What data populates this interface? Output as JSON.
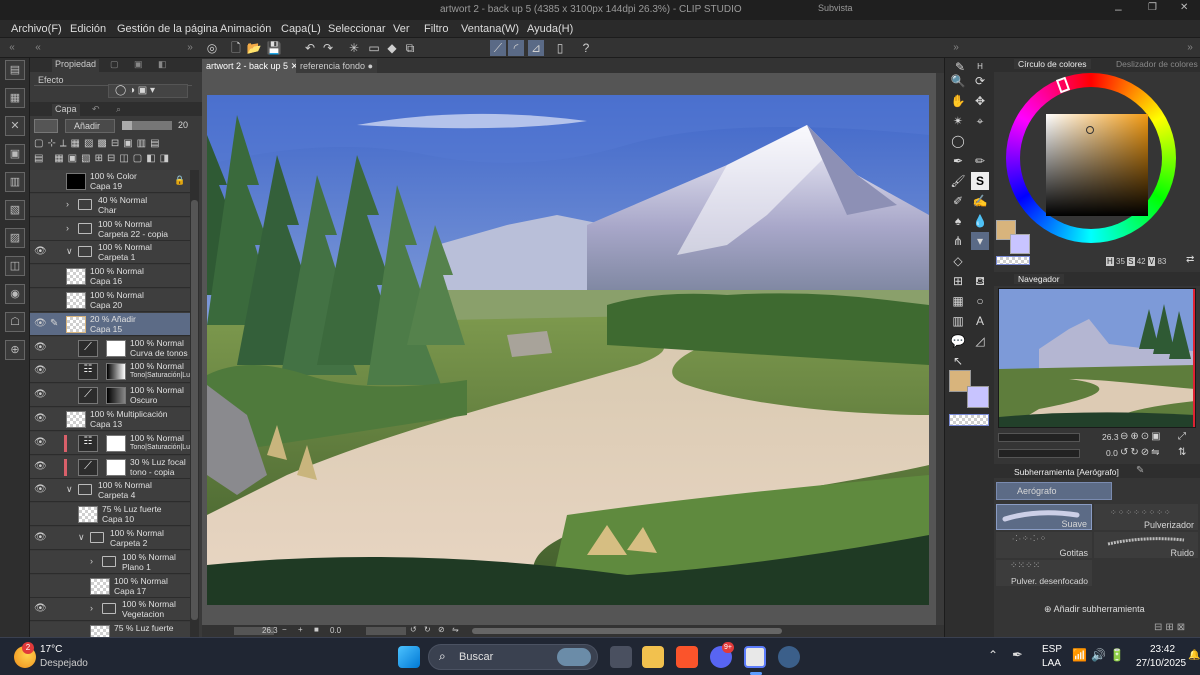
{
  "titlebar": {
    "title": "artwort 2 - back up 5 (4385 x 3100px 144dpi 26.3%)  - CLIP STUDIO",
    "subvista": "Subvista",
    "minimize": "–",
    "restore": "❐",
    "close": "✕"
  },
  "menu": [
    "Archivo(F)",
    "Edición",
    "Gestión de la página",
    "Animación",
    "Capa(L)",
    "Seleccionar",
    "Ver",
    "Filtro",
    "Ventana(W)",
    "Ayuda(H)"
  ],
  "layer_panel": {
    "tab_propiedad": "Propiedad",
    "efecto_label": "Efecto",
    "tab_capa": "Capa",
    "blend_mode": "Añadir",
    "opacity": "20",
    "layers": [
      {
        "line1": "100 % Color",
        "line2": "Capa 19",
        "thumb": "black",
        "visible": false,
        "locked": true,
        "indent": 0,
        "folder": false
      },
      {
        "line1": "40 % Normal",
        "line2": "Char",
        "thumb": "folder",
        "visible": false,
        "indent": 0,
        "folder": true,
        "expanded": false
      },
      {
        "line1": "100 % Normal",
        "line2": "Carpeta 22 - copia",
        "thumb": "folder",
        "visible": false,
        "indent": 0,
        "folder": true,
        "expanded": false
      },
      {
        "line1": "100 % Normal",
        "line2": "Carpeta 1",
        "thumb": "folder",
        "visible": true,
        "indent": 0,
        "folder": true,
        "expanded": true
      },
      {
        "line1": "100 % Normal",
        "line2": "Capa 16",
        "thumb": "checker",
        "visible": false,
        "indent": 0,
        "folder": false
      },
      {
        "line1": "100 % Normal",
        "line2": "Capa 20",
        "thumb": "checker",
        "visible": false,
        "indent": 0,
        "folder": false
      },
      {
        "line1": "20 % Añadir",
        "line2": "Capa 15",
        "thumb": "checker",
        "visible": true,
        "indent": 0,
        "folder": false,
        "selected": true,
        "editing": true
      },
      {
        "line1": "100 % Normal",
        "line2": "Curva de tonos 2",
        "thumb": "curve",
        "visible": true,
        "indent": 1,
        "folder": false,
        "mask": "white"
      },
      {
        "line1": "100 % Normal",
        "line2": "Tono|Saturación|Lu",
        "thumb": "hsl",
        "visible": true,
        "indent": 1,
        "folder": false,
        "mask": "gradient"
      },
      {
        "line1": "100 % Normal",
        "line2": "Oscuro",
        "thumb": "curve",
        "visible": true,
        "indent": 1,
        "folder": false,
        "mask": "dark"
      },
      {
        "line1": "100 % Multiplicación",
        "line2": "Capa 13",
        "thumb": "checker",
        "visible": true,
        "indent": 0,
        "folder": false
      },
      {
        "line1": "100 % Normal",
        "line2": "Tono|Saturación|Lu",
        "thumb": "hsl",
        "visible": true,
        "indent": 1,
        "folder": false,
        "mask": "white",
        "red": true
      },
      {
        "line1": "30 % Luz focal",
        "line2": "tono - copia",
        "thumb": "curve",
        "visible": true,
        "indent": 1,
        "folder": false,
        "mask": "white",
        "red": true
      },
      {
        "line1": "100 % Normal",
        "line2": "Carpeta 4",
        "thumb": "folder",
        "visible": true,
        "indent": 0,
        "folder": true,
        "expanded": true
      },
      {
        "line1": "75 % Luz fuerte",
        "line2": "Capa 10",
        "thumb": "checker",
        "visible": false,
        "indent": 1,
        "folder": false
      },
      {
        "line1": "100 % Normal",
        "line2": "Carpeta 2",
        "thumb": "folder",
        "visible": true,
        "indent": 1,
        "folder": true,
        "expanded": true
      },
      {
        "line1": "100 % Normal",
        "line2": "Plano 1",
        "thumb": "folder",
        "visible": false,
        "indent": 2,
        "folder": true,
        "expanded": false
      },
      {
        "line1": "100 % Normal",
        "line2": "Capa 17",
        "thumb": "checker",
        "visible": false,
        "indent": 2,
        "folder": false
      },
      {
        "line1": "100 % Normal",
        "line2": "Vegetacion",
        "thumb": "folder",
        "visible": true,
        "indent": 2,
        "folder": true,
        "expanded": false
      },
      {
        "line1": "75 % Luz fuerte",
        "line2": "",
        "thumb": "checker",
        "visible": false,
        "indent": 2,
        "folder": false
      }
    ]
  },
  "canvas": {
    "tab_active": "artwort 2 - back up 5",
    "tab_other": "referencia fondo",
    "zoom": "26.3",
    "angle": "0.0"
  },
  "color_panel": {
    "tab_circle": "Círculo de colores",
    "tab_slider": "Deslizador de colores",
    "h_label": "H",
    "h_value": "35",
    "s_label": "S",
    "s_value": "42",
    "v_label": "V",
    "v_value": "83",
    "main_color": "#d8b47c",
    "sub_color": "#c8c4ff",
    "square_hue": "#f29a12"
  },
  "navigator": {
    "tab": "Navegador",
    "zoom": "26.3",
    "angle": "0.0"
  },
  "subtool": {
    "header": "Subherramienta [Aerógrafo]",
    "group": "Aerógrafo",
    "items": [
      "Suave",
      "Pulverizador",
      "Gotitas",
      "Ruido",
      "Pulver. desenfocado"
    ],
    "add_label": "Añadir subherramienta"
  },
  "taskbar": {
    "temperature": "17°C",
    "weather": "Despejado",
    "weather_badge": "2",
    "search": "Buscar",
    "discord_badge": "9+",
    "lang1": "ESP",
    "lang2": "LAA",
    "time": "23:42",
    "date": "27/10/2025"
  }
}
